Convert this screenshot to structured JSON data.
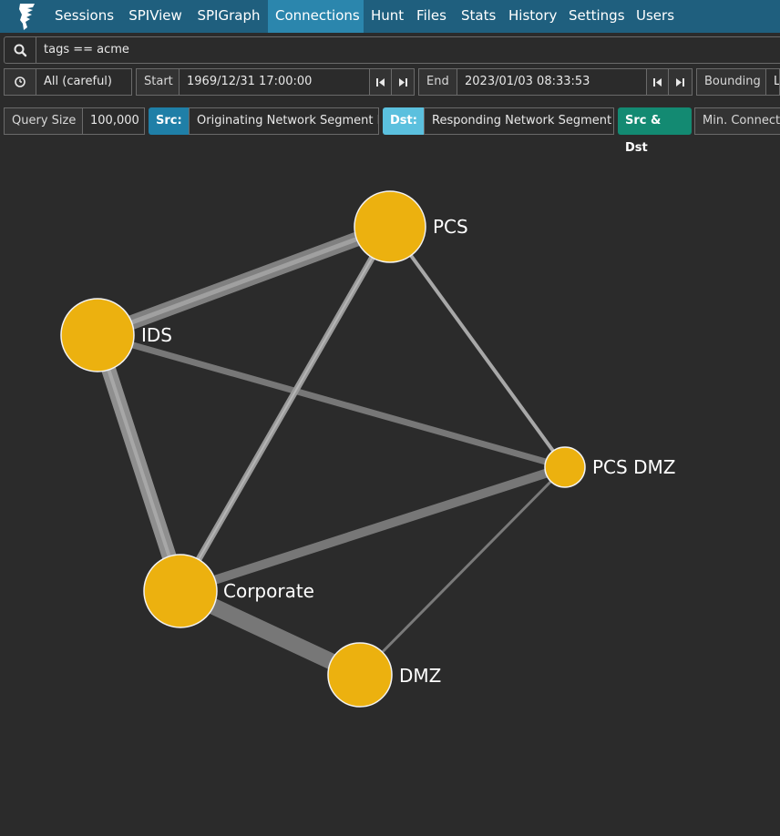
{
  "nav": {
    "items": [
      {
        "label": "Sessions",
        "active": false
      },
      {
        "label": "SPIView",
        "active": false
      },
      {
        "label": "SPIGraph",
        "active": false
      },
      {
        "label": "Connections",
        "active": true
      },
      {
        "label": "Hunt",
        "active": false
      },
      {
        "label": "Files",
        "active": false
      },
      {
        "label": "Stats",
        "active": false
      },
      {
        "label": "History",
        "active": false
      },
      {
        "label": "Settings",
        "active": false
      },
      {
        "label": "Users",
        "active": false
      }
    ]
  },
  "search": {
    "query": "tags == acme",
    "icon": "search-icon"
  },
  "time": {
    "range_label": "All (careful)",
    "start_label": "Start",
    "start_value": "1969/12/31 17:00:00",
    "end_label": "End",
    "end_value": "2023/01/03 08:33:53",
    "bounding_label": "Bounding",
    "bounding_value": "L"
  },
  "controls": {
    "query_size_label": "Query Size",
    "query_size_value": "100,000",
    "src_label": "Src:",
    "src_value": "Originating Network Segment Name",
    "dst_label": "Dst:",
    "dst_value": "Responding Network Segment",
    "src_dst_label": "Src & Dst",
    "min_conn_label": "Min. Connections"
  },
  "colors": {
    "navbar": "#1f5f7e",
    "nav_active": "#2b86ad",
    "node": "#ecb10f",
    "background": "#2b2b2b"
  },
  "graph": {
    "nodes": [
      {
        "id": "PCS",
        "label": "PCS"
      },
      {
        "id": "IDS",
        "label": "IDS"
      },
      {
        "id": "PCS DMZ",
        "label": "PCS DMZ"
      },
      {
        "id": "Corporate",
        "label": "Corporate"
      },
      {
        "id": "DMZ",
        "label": "DMZ"
      }
    ]
  }
}
